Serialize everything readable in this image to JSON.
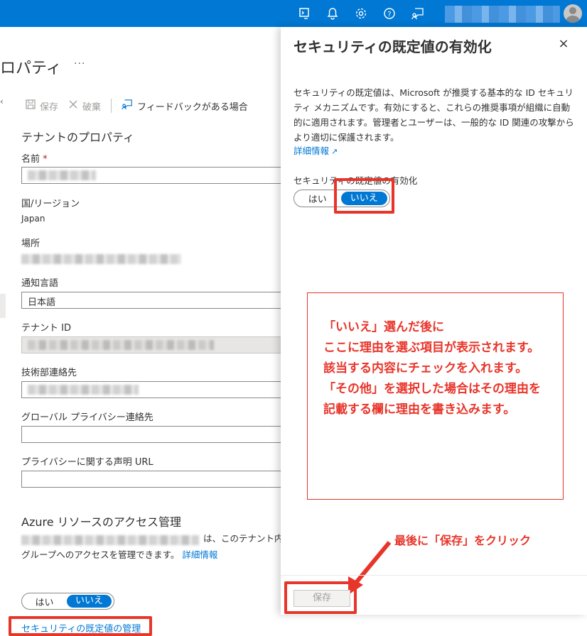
{
  "topbar": {
    "icons": [
      "cloud-shell-icon",
      "bell-icon",
      "gear-icon",
      "help-icon",
      "feedback-icon"
    ]
  },
  "left": {
    "page_title": "ロパティ",
    "ellipsis": "···",
    "toolbar": {
      "save": "保存",
      "discard": "破棄",
      "feedback": "フィードバックがある場合"
    },
    "tenant_heading": "テナントのプロパティ",
    "name_label": "名前",
    "required_mark": "*",
    "country_label": "国/リージョン",
    "country_value": "Japan",
    "location_label": "場所",
    "notify_lang_label": "通知言語",
    "notify_lang_value": "日本語",
    "tenant_id_label": "テナント ID",
    "tech_contact_label": "技術部連絡先",
    "privacy_contact_label": "グローバル プライバシー連絡先",
    "privacy_url_label": "プライバシーに関する声明 URL",
    "azure_heading": "Azure リソースのアクセス管理",
    "azure_line1": "は、このテナント内",
    "azure_line2": "グループへのアクセスを管理できます。",
    "azure_more": "詳細情報",
    "toggle_yes": "はい",
    "toggle_no": "いいえ",
    "manage_defaults_link": "セキュリティの既定値の管理"
  },
  "panel": {
    "title": "セキュリティの既定値の有効化",
    "close": "×",
    "description": "セキュリティの既定値は、Microsoft が推奨する基本的な ID セキュリティ メカニズムです。有効にすると、これらの推奨事項が組織に自動的に適用されます。管理者とユーザーは、一般的な ID 関連の攻撃からより適切に保護されます。",
    "more": "詳細情報",
    "toggle_label": "セキュリティの既定値の有効化",
    "toggle_yes": "はい",
    "toggle_no": "いいえ",
    "save_button": "保存"
  },
  "annotations": {
    "note": "「いいえ」選んだ後に\nここに理由を選ぶ項目が表示されます。該当する内容にチェックを入れます。\n「その他」を選択した場合はその理由を記載する欄に理由を書き込みます。",
    "final_note": "最後に「保存」をクリック",
    "color": "#e8352a"
  },
  "colors": {
    "accent": "#0078d4",
    "topbar": "#0078d4",
    "annotation": "#e8352a"
  }
}
